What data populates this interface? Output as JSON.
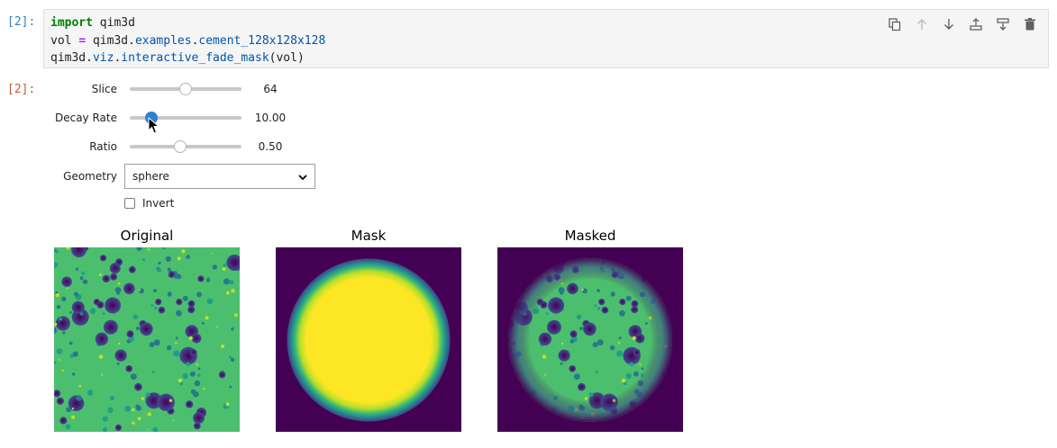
{
  "input_prompt": "[2]:",
  "output_prompt": "[2]:",
  "code": {
    "line1": {
      "kw": "import",
      "rest": " qim3d"
    },
    "line2": {
      "a": "vol ",
      "op": "=",
      "b": " qim3d",
      "c": ".",
      "d": "examples",
      "e": ".",
      "f": "cement_128x128x128"
    },
    "line3": {
      "a": "qim3d",
      "b": ".",
      "c": "viz",
      "d": ".",
      "e": "interactive_fade_mask",
      "f": "(vol)"
    }
  },
  "toolbar": {
    "icons": [
      "duplicate-icon",
      "move-up-icon",
      "move-down-icon",
      "insert-above-icon",
      "insert-below-icon",
      "delete-icon"
    ]
  },
  "widgets": {
    "slice": {
      "label": "Slice",
      "value": "64",
      "fraction": 0.5
    },
    "decay": {
      "label": "Decay Rate",
      "value": "10.00",
      "fraction": 0.19
    },
    "ratio": {
      "label": "Ratio",
      "value": "0.50",
      "fraction": 0.45
    },
    "geometry": {
      "label": "Geometry",
      "selected": "sphere"
    },
    "invert": {
      "label": "Invert",
      "checked": false
    }
  },
  "figures": {
    "original": {
      "title": "Original"
    },
    "mask": {
      "title": "Mask"
    },
    "masked": {
      "title": "Masked"
    }
  },
  "colors": {
    "viridis_dark": "#440154",
    "viridis_yellow": "#fde725",
    "viridis_green": "#5ec962",
    "slider_active": "#2f7fd0"
  }
}
